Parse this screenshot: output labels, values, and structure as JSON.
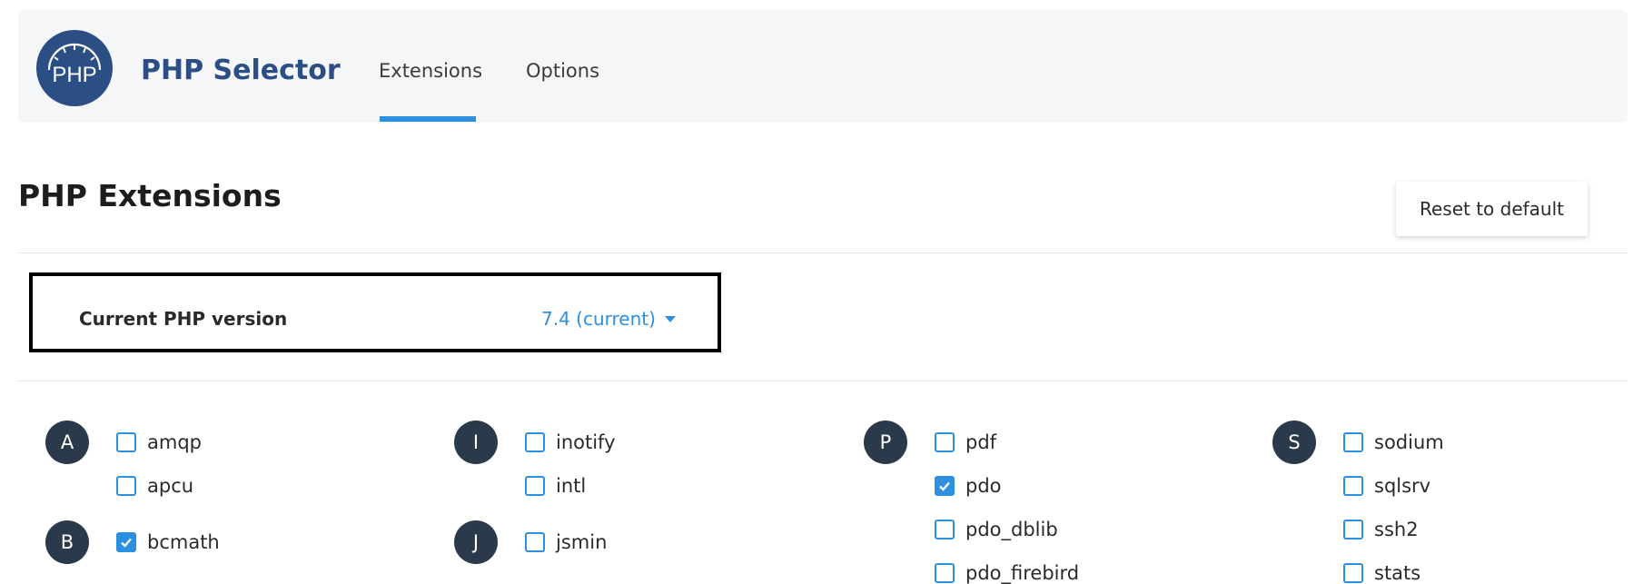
{
  "header": {
    "logo_text": "PHP",
    "title": "PHP Selector",
    "tabs": [
      {
        "label": "Extensions",
        "active": true
      },
      {
        "label": "Options",
        "active": false
      }
    ]
  },
  "page": {
    "title": "PHP Extensions",
    "reset_label": "Reset to default"
  },
  "version": {
    "label": "Current PHP version",
    "value": "7.4 (current)"
  },
  "colors": {
    "accent": "#2d8fe0",
    "brand": "#2b4f85",
    "letter_badge": "#2b3a4a"
  },
  "groups": [
    {
      "letter": "A",
      "items": [
        {
          "name": "amqp",
          "checked": false
        },
        {
          "name": "apcu",
          "checked": false
        }
      ]
    },
    {
      "letter": "B",
      "items": [
        {
          "name": "bcmath",
          "checked": true
        }
      ]
    },
    {
      "letter": "I",
      "items": [
        {
          "name": "inotify",
          "checked": false
        },
        {
          "name": "intl",
          "checked": false
        }
      ]
    },
    {
      "letter": "J",
      "items": [
        {
          "name": "jsmin",
          "checked": false
        }
      ]
    },
    {
      "letter": "P",
      "items": [
        {
          "name": "pdf",
          "checked": false
        },
        {
          "name": "pdo",
          "checked": true
        },
        {
          "name": "pdo_dblib",
          "checked": false
        },
        {
          "name": "pdo_firebird",
          "checked": false
        }
      ]
    },
    {
      "letter": "S",
      "items": [
        {
          "name": "sodium",
          "checked": false
        },
        {
          "name": "sqlsrv",
          "checked": false
        },
        {
          "name": "ssh2",
          "checked": false
        },
        {
          "name": "stats",
          "checked": false
        }
      ]
    }
  ]
}
